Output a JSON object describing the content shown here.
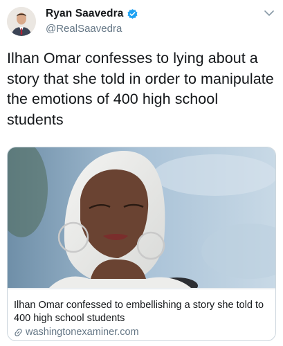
{
  "tweet": {
    "author": {
      "display_name": "Ryan Saavedra",
      "handle": "@RealSaavedra",
      "verified": true
    },
    "text": "Ilhan Omar confesses to lying about a story that she told in order to manipulate the emotions of 400 high school students",
    "card": {
      "title": "Ilhan Omar confessed to embellishing a story she told to 400 high school students",
      "domain": "washingtonexaminer.com"
    }
  },
  "icons": {
    "verified": "verified-badge-icon",
    "menu": "chevron-down-icon",
    "link": "link-icon"
  },
  "colors": {
    "verified_blue": "#1da1f2",
    "secondary_text": "#657786",
    "border": "#ccd6dd"
  }
}
